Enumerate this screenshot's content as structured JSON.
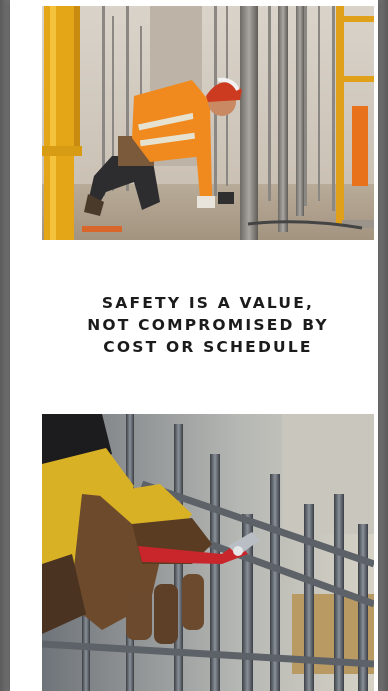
{
  "headline": {
    "lines": [
      "SAFETY IS A VALUE,",
      "NOT COMPROMISED BY",
      "COST OR SCHEDULE"
    ]
  },
  "images": {
    "top": {
      "icon": "construction-worker-photo"
    },
    "bottom": {
      "icon": "rebar-gloves-pliers-photo"
    }
  },
  "colors": {
    "page_background": "#ffffff",
    "outer_background": "#6b6b6b",
    "headline_text": "#1b1b1b",
    "safety_orange": "#f08a1f",
    "scaffold_yellow": "#e4a617",
    "glove_yellow": "#d9b125"
  }
}
